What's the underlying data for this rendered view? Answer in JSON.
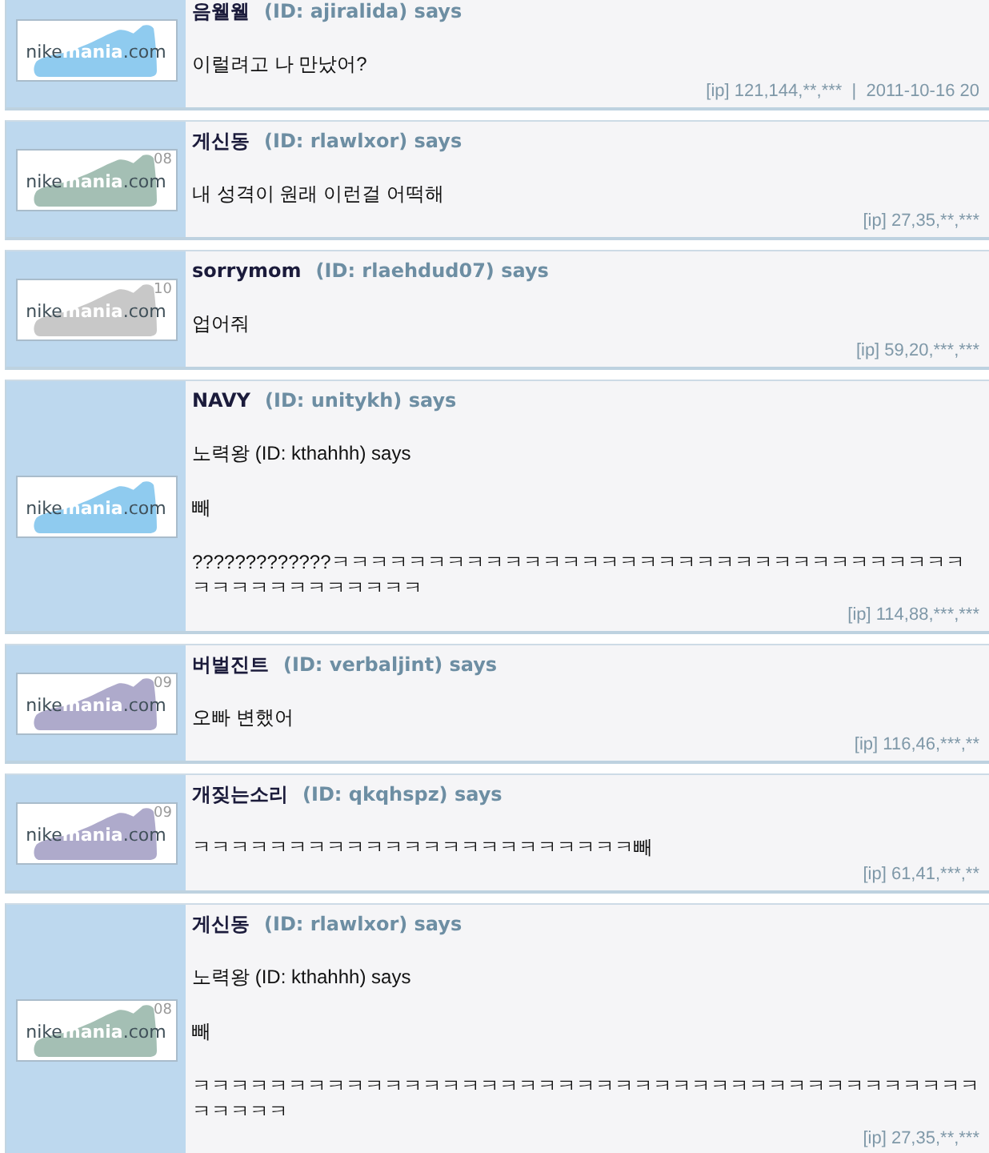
{
  "posts": [
    {
      "author": "음웰웰",
      "id_label": "(ID: ajiralida) says",
      "avatar": {
        "color": "#8fcbef",
        "logo": [
          "nike",
          "mania",
          ".com"
        ]
      },
      "body": [
        "이럴려고 나 만났어?"
      ],
      "meta": "[ip] 121,144,**,***  |  2011-10-16 20"
    },
    {
      "author": "게신동",
      "id_label": "(ID: rlawlxor) says",
      "avatar": {
        "color": "#a4bfb4",
        "logo": [
          "nike",
          "mania",
          ".com"
        ],
        "badge": "08"
      },
      "body": [
        "내 성격이 원래 이런걸 어떡해"
      ],
      "meta": "[ip] 27,35,**,***"
    },
    {
      "author": "sorrymom",
      "id_label": "(ID: rlaehdud07) says",
      "avatar": {
        "color": "#c8c8c8",
        "logo": [
          "nike",
          "mania",
          ".com"
        ],
        "badge": "10"
      },
      "body": [
        "업어줘"
      ],
      "meta": "[ip] 59,20,***,***"
    },
    {
      "author": "NAVY",
      "id_label": "(ID: unitykh) says",
      "avatar": {
        "color": "#8fcbef",
        "logo": [
          "nike",
          "mania",
          ".com"
        ]
      },
      "body": [
        "노력왕 (ID: kthahhh) says",
        "빼",
        "?????????????ㅋㅋㅋㅋㅋㅋㅋㅋㅋㅋㅋㅋㅋㅋㅋㅋㅋㅋㅋㅋㅋㅋㅋㅋㅋㅋㅋㅋㅋㅋㅋㅋㅋㅋㅋㅋㅋㅋㅋㅋㅋㅋㅋㅋㅋ"
      ],
      "meta": "[ip] 114,88,***,***"
    },
    {
      "author": "버벌진트",
      "id_label": "(ID: verbaljint) says",
      "avatar": {
        "color": "#aeaacb",
        "logo": [
          "nike",
          "mania",
          ".com"
        ],
        "badge": "09"
      },
      "body": [
        "오빠 변했어"
      ],
      "meta": "[ip] 116,46,***,**"
    },
    {
      "author": "개짖는소리",
      "id_label": "(ID: qkqhspz) says",
      "avatar": {
        "color": "#aeaacb",
        "logo": [
          "nike",
          "mania",
          ".com"
        ],
        "badge": "09"
      },
      "body": [
        "ㅋㅋㅋㅋㅋㅋㅋㅋㅋㅋㅋㅋㅋㅋㅋㅋㅋㅋㅋㅋㅋㅋㅋ빼"
      ],
      "meta": "[ip] 61,41,***,**"
    },
    {
      "author": "게신동",
      "id_label": "(ID: rlawlxor) says",
      "avatar": {
        "color": "#a4bfb4",
        "logo": [
          "nike",
          "mania",
          ".com"
        ],
        "badge": "08"
      },
      "body": [
        "노력왕 (ID: kthahhh) says",
        "빼",
        "ㅋㅋㅋㅋㅋㅋㅋㅋㅋㅋㅋㅋㅋㅋㅋㅋㅋㅋㅋㅋㅋㅋㅋㅋㅋㅋㅋㅋㅋㅋㅋㅋㅋㅋㅋㅋㅋㅋㅋㅋㅋㅋㅋㅋㅋㅋ"
      ],
      "meta": "[ip] 27,35,**,***"
    }
  ]
}
